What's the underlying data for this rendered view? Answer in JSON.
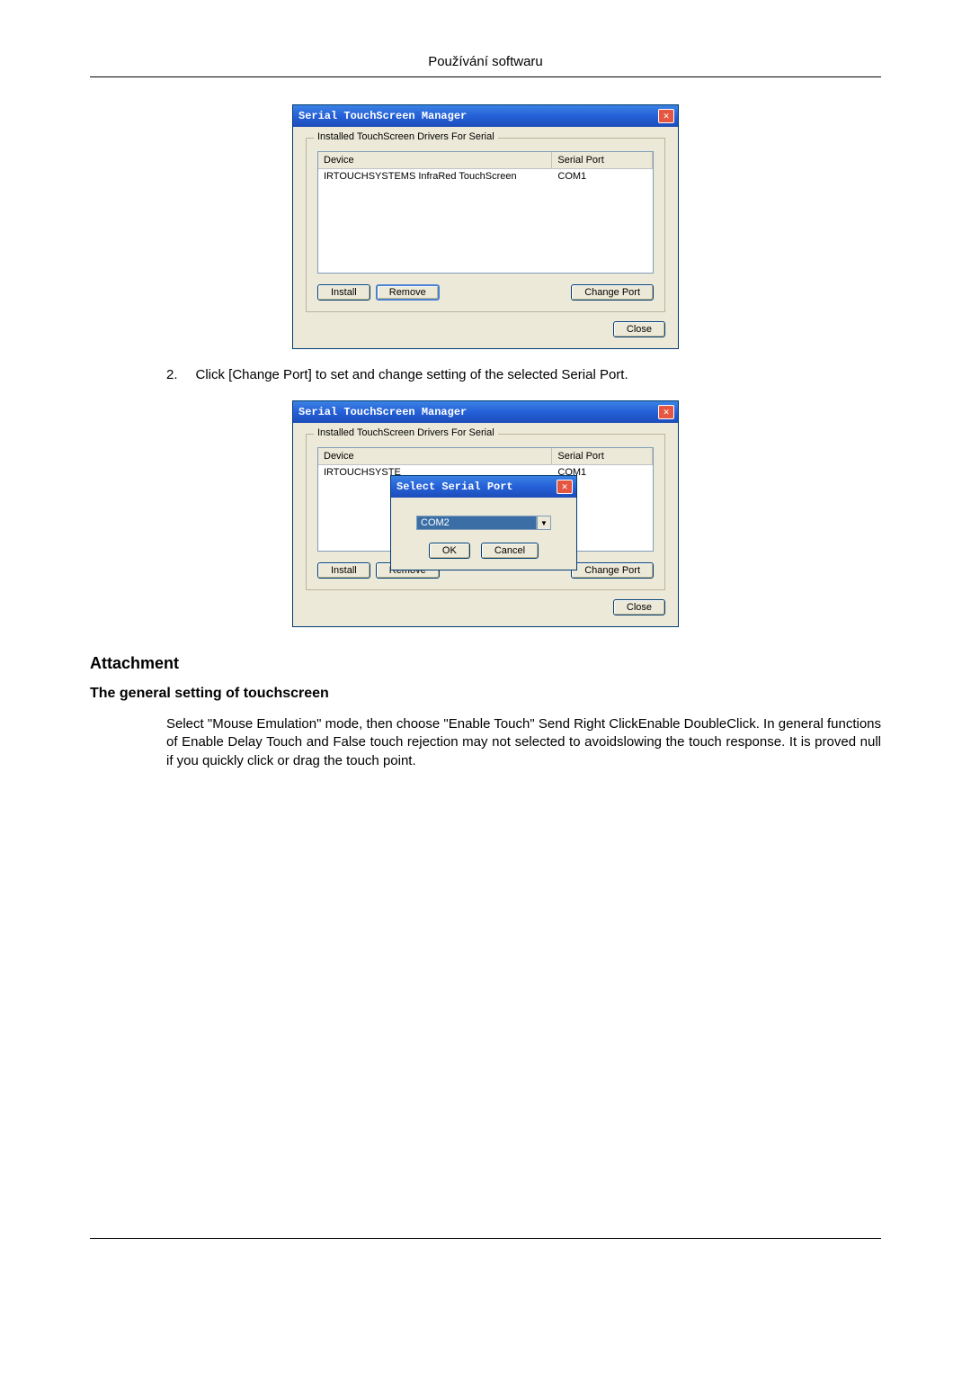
{
  "header": {
    "title": "Používání softwaru"
  },
  "dialog1": {
    "title": "Serial TouchScreen Manager",
    "group_label": "Installed TouchScreen Drivers For Serial",
    "col_device": "Device",
    "col_port": "Serial Port",
    "row_device": "IRTOUCHSYSTEMS InfraRed TouchScreen",
    "row_port": "COM1",
    "btn_install": "Install",
    "btn_remove": "Remove",
    "btn_change": "Change Port",
    "btn_close": "Close"
  },
  "step2": {
    "num": "2.",
    "text": "Click [Change Port] to set and change setting of the selected Serial Port."
  },
  "dialog2": {
    "title": "Serial TouchScreen Manager",
    "group_label": "Installed TouchScreen Drivers For Serial",
    "col_device": "Device",
    "col_port": "Serial Port",
    "row_device": "IRTOUCHSYSTE",
    "row_port": "COM1",
    "btn_install": "Install",
    "btn_remove": "Remove",
    "btn_change": "Change Port",
    "btn_close": "Close",
    "sub_title": "Select Serial Port",
    "combo_value": "COM2",
    "btn_ok": "OK",
    "btn_cancel": "Cancel"
  },
  "attachment": {
    "heading": "Attachment",
    "subheading": "The general setting of touchscreen",
    "paragraph": "Select \"Mouse Emulation\" mode, then choose \"Enable Touch\" Send Right ClickEnable DoubleClick. In general functions of Enable Delay Touch and False touch rejection may not selected to avoidslowing the touch response. It is proved null if you quickly click or drag the touch point."
  }
}
